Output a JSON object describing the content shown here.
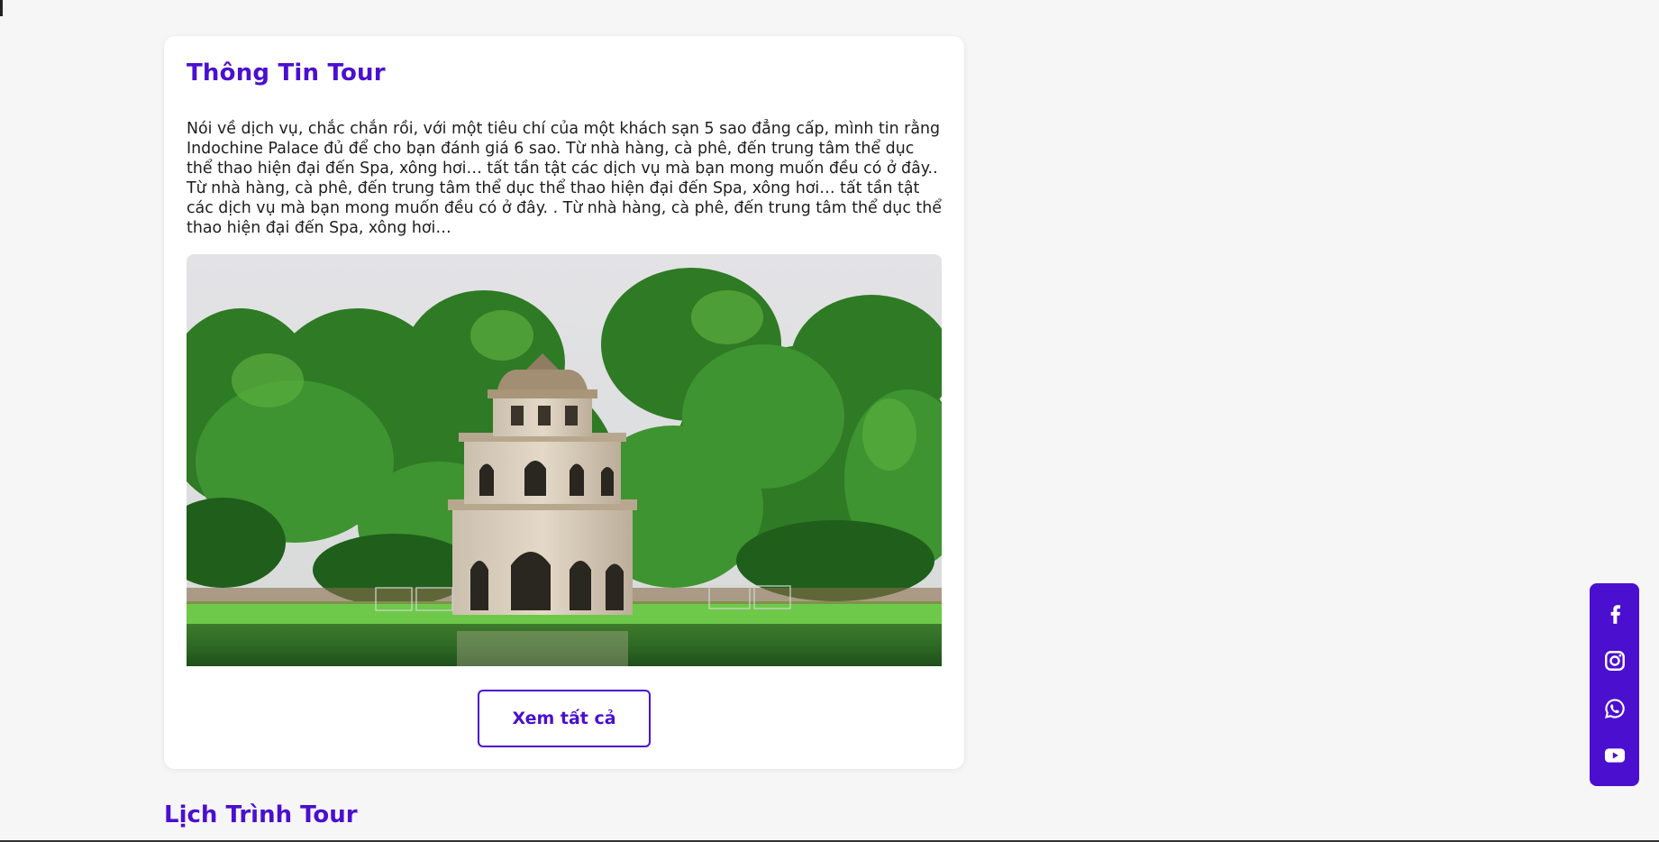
{
  "tour_info": {
    "title": "Thông Tin Tour",
    "description": "Nói về dịch vụ, chắc chắn rồi, với một tiêu chí của một khách sạn 5 sao đẳng cấp, mình tin rằng Indochine Palace đủ để cho bạn đánh giá 6 sao. Từ nhà hàng, cà phê, đến trung tâm thể dục thể thao hiện đại đến Spa, xông hơi… tất tần tật các dịch vụ mà bạn mong muốn đều có ở đây.. Từ nhà hàng, cà phê, đến trung tâm thể dục thể thao hiện đại đến Spa, xông hơi… tất tần tật các dịch vụ mà bạn mong muốn đều có ở đây. . Từ nhà hàng, cà phê, đến trung tâm thể dục thể thao hiện đại đến Spa, xông hơi…",
    "view_all_label": "Xem tất cả"
  },
  "schedule": {
    "title": "Lịch Trình Tour"
  },
  "social": {
    "items": [
      {
        "icon": "facebook-icon"
      },
      {
        "icon": "instagram-icon"
      },
      {
        "icon": "whatsapp-icon"
      },
      {
        "icon": "youtube-icon"
      }
    ]
  },
  "colors": {
    "accent": "#4b0fd0",
    "background": "#f6f6f6",
    "card": "#ffffff"
  }
}
